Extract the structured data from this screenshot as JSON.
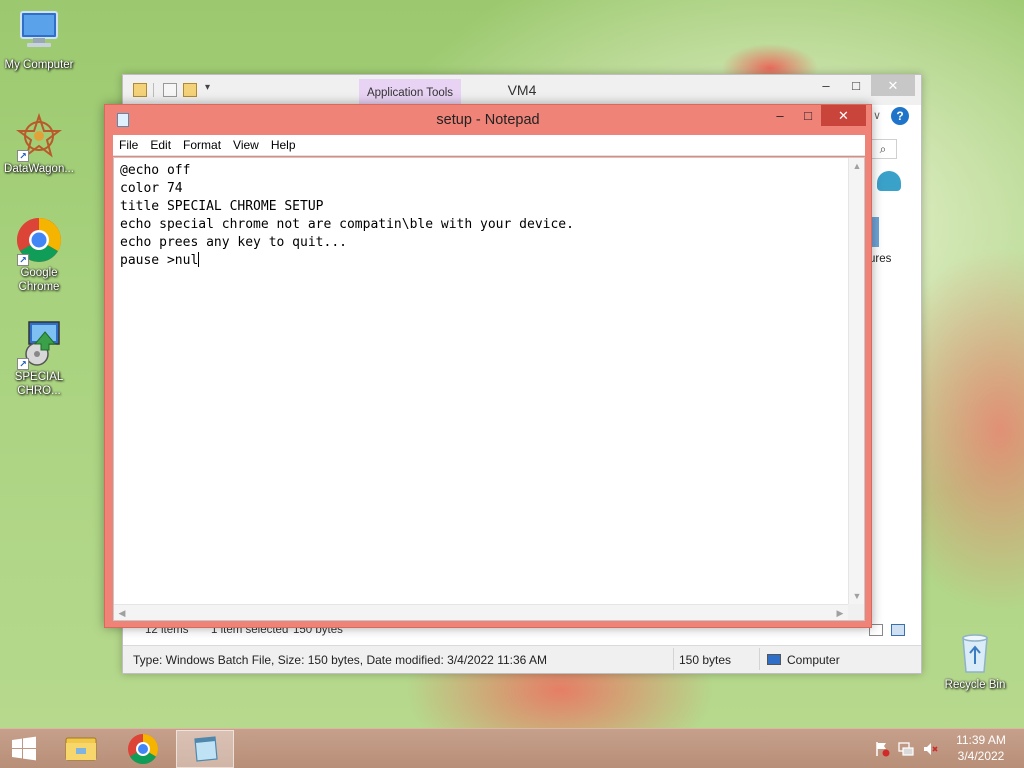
{
  "desktop": {
    "icons": [
      {
        "label": "My Computer",
        "icon": "computer-icon"
      },
      {
        "label": "DataWagon...",
        "icon": "datawagon-icon"
      },
      {
        "label": "Google Chrome",
        "icon": "chrome-icon"
      },
      {
        "label": "SPECIAL CHRO...",
        "icon": "installer-icon"
      },
      {
        "label": "Recycle Bin",
        "icon": "recycle-bin-icon"
      }
    ]
  },
  "explorer": {
    "app_tools_label": "Application Tools",
    "title": "VM4",
    "right_pane_label": "ures",
    "status": {
      "item_count": "12 items",
      "selected": "1 item selected",
      "selected_size": "150 bytes"
    },
    "details": {
      "description": "Type: Windows Batch File, Size: 150 bytes, Date modified: 3/4/2022 11:36 AM",
      "size": "150 bytes",
      "location": "Computer"
    }
  },
  "notepad": {
    "title": "setup - Notepad",
    "menu": [
      "File",
      "Edit",
      "Format",
      "View",
      "Help"
    ],
    "content": "@echo off\ncolor 74\ntitle SPECIAL CHROME SETUP\necho special chrome not are compatin\\ble with your device.\necho prees any key to quit...\npause >nul",
    "controls": {
      "minimize": "–",
      "maximize": "□",
      "close": "✕"
    }
  },
  "taskbar": {
    "clock_time": "11:39 AM",
    "clock_date": "3/4/2022",
    "pinned": [
      "file-explorer-icon",
      "chrome-icon",
      "notepad-icon"
    ]
  },
  "colors": {
    "notepad_frame": "#f08378",
    "close_button": "#c9453b",
    "taskbar": "#bf9682",
    "app_tools": "#e9d3f4"
  }
}
